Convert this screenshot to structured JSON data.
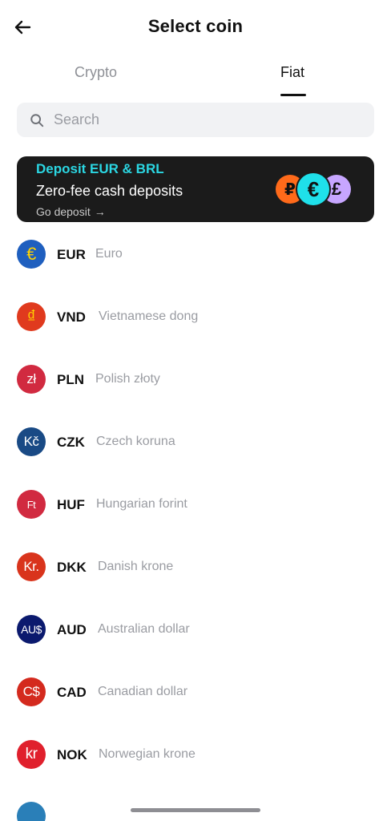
{
  "header": {
    "title": "Select coin"
  },
  "tabs": [
    {
      "label": "Crypto",
      "active": false
    },
    {
      "label": "Fiat",
      "active": true
    }
  ],
  "search": {
    "placeholder": "Search",
    "value": ""
  },
  "banner": {
    "title": "Deposit EUR & BRL",
    "subtitle": "Zero-fee cash deposits",
    "cta": "Go deposit",
    "cta_arrow": "→",
    "coin_symbols": [
      "₽",
      "€",
      "£"
    ],
    "title_color": "#2bd7e3",
    "background": "#1b1b1b"
  },
  "currencies": [
    {
      "code": "EUR",
      "name": "Euro",
      "symbol": "€",
      "icon_color": "#1f5fbf",
      "symbol_color": "#ffd200"
    },
    {
      "code": "VND",
      "name": "Vietnamese dong",
      "symbol": "₫",
      "icon_color": "#e03a1e",
      "symbol_color": "#ffd200"
    },
    {
      "code": "PLN",
      "name": "Polish złoty",
      "symbol": "zł",
      "icon_color": "#d12a40",
      "symbol_color": "#ffffff"
    },
    {
      "code": "CZK",
      "name": "Czech koruna",
      "symbol": "Kč",
      "icon_color": "#194a85",
      "symbol_color": "#ffffff"
    },
    {
      "code": "HUF",
      "name": "Hungarian forint",
      "symbol": "Ft",
      "icon_color": "#d12a40",
      "symbol_color": "#ffffff"
    },
    {
      "code": "DKK",
      "name": "Danish krone",
      "symbol": "Kr.",
      "icon_color": "#d9341c",
      "symbol_color": "#ffffff"
    },
    {
      "code": "AUD",
      "name": "Australian dollar",
      "symbol": "AU$",
      "icon_color": "#0b1a6e",
      "symbol_color": "#ffffff"
    },
    {
      "code": "CAD",
      "name": "Canadian dollar",
      "symbol": "C$",
      "icon_color": "#d42a1e",
      "symbol_color": "#ffffff"
    },
    {
      "code": "NOK",
      "name": "Norwegian krone",
      "symbol": "kr",
      "icon_color": "#e0202d",
      "symbol_color": "#ffffff"
    }
  ],
  "icons": {
    "back": "arrow-left-icon",
    "search": "search-icon"
  }
}
